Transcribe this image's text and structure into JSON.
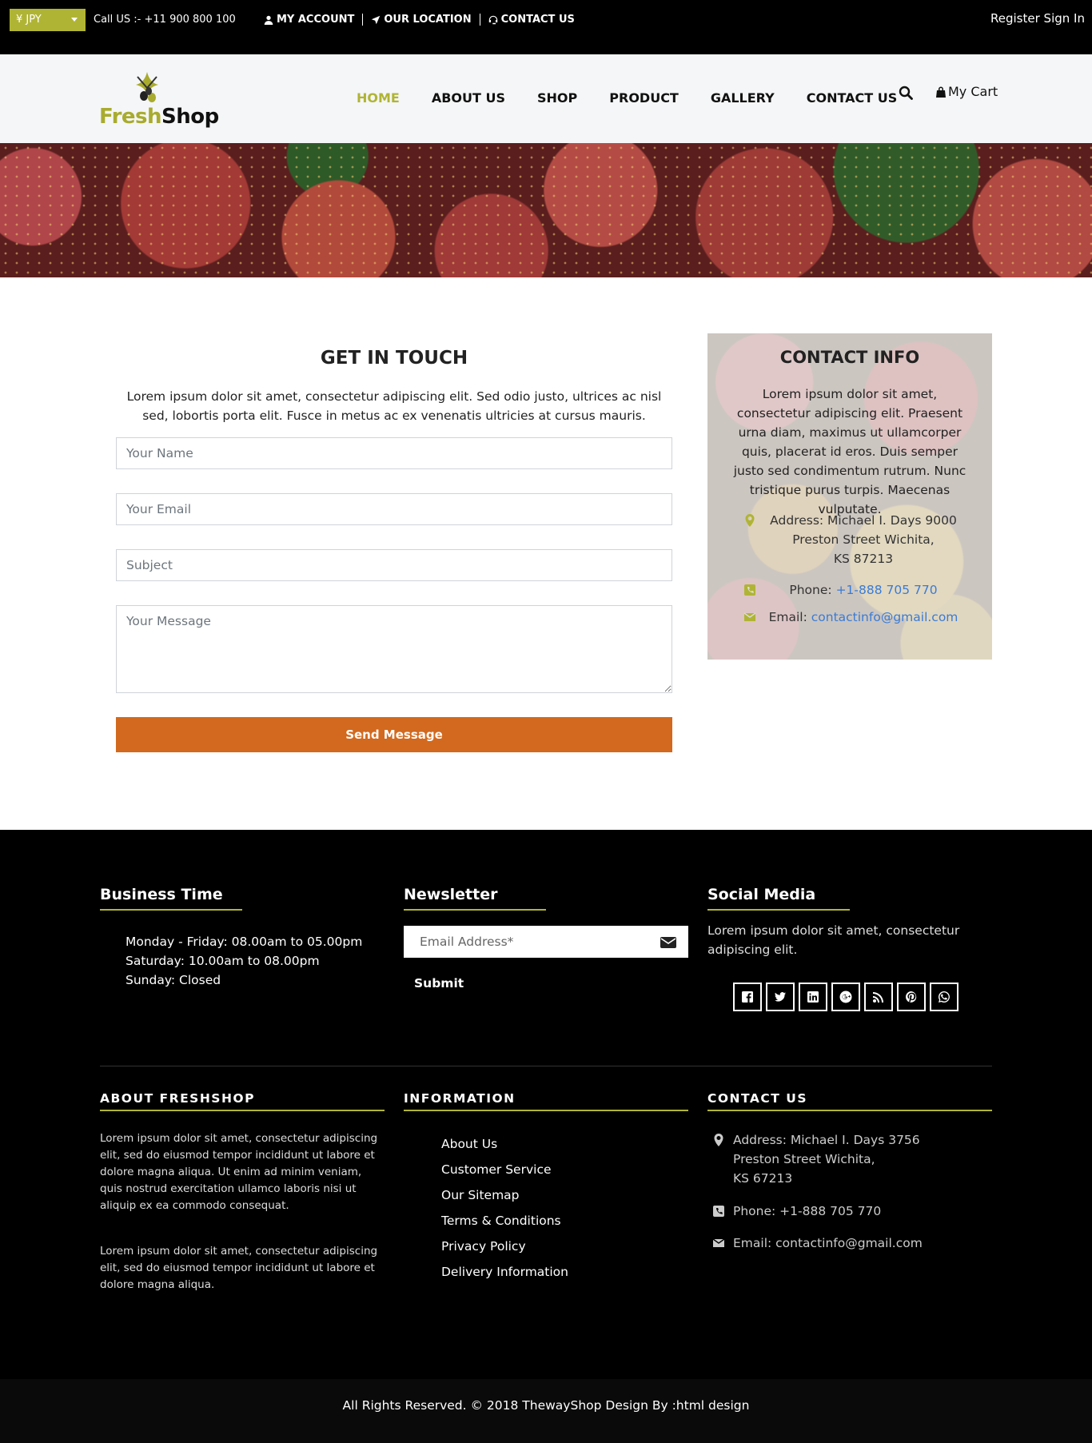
{
  "topbar": {
    "currency": "¥ JPY",
    "call_us": "Call US :- +11 900 800 100",
    "links": [
      "MY ACCOUNT",
      "OUR LOCATION",
      "CONTACT US"
    ],
    "register_sign_in": "Register Sign In"
  },
  "header": {
    "logo_fresh": "Fresh",
    "logo_shop": "Shop",
    "nav": [
      "HOME",
      "ABOUT US",
      "SHOP",
      "PRODUCT",
      "GALLERY",
      "CONTACT US"
    ],
    "active_nav": "HOME",
    "cart_label": "My Cart"
  },
  "get_in_touch": {
    "title": "GET IN TOUCH",
    "text": "Lorem ipsum dolor sit amet, consectetur adipiscing elit. Sed odio justo, ultrices ac nisl sed, lobortis porta elit. Fusce in metus ac ex venenatis ultricies at cursus mauris.",
    "name_placeholder": "Your Name",
    "email_placeholder": "Your Email",
    "subject_placeholder": "Subject",
    "message_placeholder": "Your Message",
    "send_label": "Send Message"
  },
  "contact_info": {
    "title": "CONTACT INFO",
    "text": "Lorem ipsum dolor sit amet, consectetur adipiscing elit. Praesent urna diam, maximus ut ullamcorper quis, placerat id eros. Duis semper justo sed condimentum rutrum. Nunc tristique purus turpis. Maecenas vulputate.",
    "address_line1": "Address: Michael I. Days 9000",
    "address_line2": "Preston Street Wichita,",
    "address_line3": "KS 87213",
    "phone_label": "Phone:",
    "phone": "+1-888 705 770",
    "email_label": "Email:",
    "email": "contactinfo@gmail.com"
  },
  "footer": {
    "business_time": {
      "title": "Business Time",
      "lines": [
        "Monday - Friday: 08.00am to 05.00pm",
        "Saturday: 10.00am to 08.00pm",
        "Sunday: Closed"
      ]
    },
    "newsletter": {
      "title": "Newsletter",
      "placeholder": "Email Address*",
      "submit_label": "Submit"
    },
    "social_media": {
      "title": "Social Media",
      "text": "Lorem ipsum dolor sit amet, consectetur adipiscing elit.",
      "icons": [
        "facebook-icon",
        "twitter-icon",
        "linkedin-icon",
        "google-plus-icon",
        "rss-icon",
        "pinterest-icon",
        "whatsapp-icon"
      ]
    },
    "about": {
      "title": "ABOUT FRESHSHOP",
      "p1": "Lorem ipsum dolor sit amet, consectetur adipiscing elit, sed do eiusmod tempor incididunt ut labore et dolore magna aliqua. Ut enim ad minim veniam, quis nostrud exercitation ullamco laboris nisi ut aliquip ex ea commodo consequat.",
      "p2": "Lorem ipsum dolor sit amet, consectetur adipiscing elit, sed do eiusmod tempor incididunt ut labore et dolore magna aliqua."
    },
    "information": {
      "title": "INFORMATION",
      "links": [
        "About Us",
        "Customer Service",
        "Our Sitemap",
        "Terms & Conditions",
        "Privacy Policy",
        "Delivery Information"
      ]
    },
    "contact": {
      "title": "CONTACT US",
      "address_line1": "Address: Michael I. Days 3756",
      "address_line2": "Preston Street Wichita,",
      "address_line3": "KS 67213",
      "phone": "Phone: +1-888 705 770",
      "email": "Email: contactinfo@gmail.com"
    },
    "copyright": "All Rights Reserved. © 2018 ThewayShop Design By :html design"
  },
  "colors": {
    "accent": "#b0b435",
    "button": "#d2691e",
    "link": "#3a7bd5",
    "footer_bg": "#000000"
  }
}
